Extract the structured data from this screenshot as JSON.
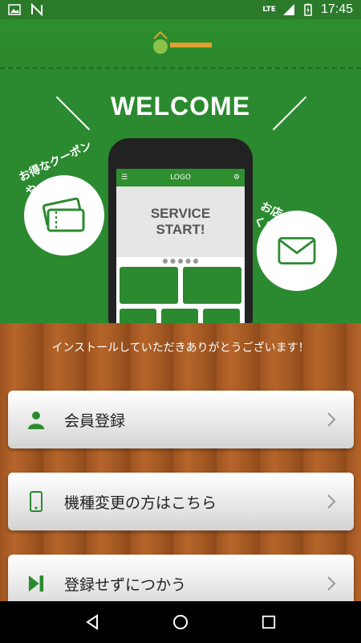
{
  "status_bar": {
    "time": "17:45",
    "network": "LTE"
  },
  "hero": {
    "welcome": "WELCOME",
    "left_bubble_text": "お得なクーポンや",
    "right_bubble_text": "お店の情報が届く!",
    "phone": {
      "logo": "LOGO",
      "service_text": "SERVICE\nSTART!",
      "dots": "● ● ● ● ●"
    }
  },
  "main": {
    "thanks_text": "インストールしていただきありがとうございます！",
    "buttons": [
      {
        "label": "会員登録",
        "icon": "person-icon"
      },
      {
        "label": "機種変更の方はこちら",
        "icon": "phone-icon"
      },
      {
        "label": "登録せずにつかう",
        "icon": "skip-forward-icon"
      }
    ]
  },
  "colors": {
    "brand_green": "#2b8a2f",
    "wood": "#9e5420"
  }
}
